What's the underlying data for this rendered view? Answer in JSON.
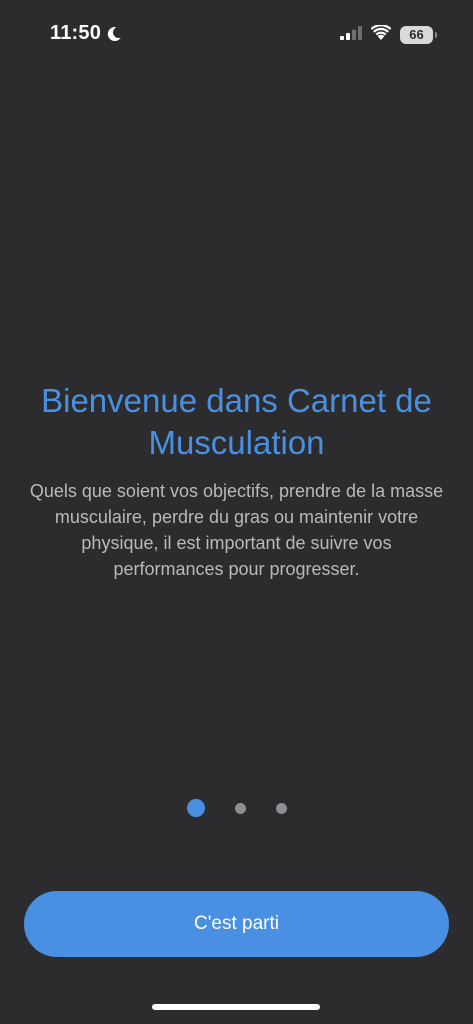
{
  "status_bar": {
    "time": "11:50",
    "battery": "66",
    "icons": [
      "moon-icon",
      "cellular-signal-icon",
      "wifi-icon",
      "battery-icon"
    ]
  },
  "onboarding": {
    "title": "Bienvenue dans Carnet de Musculation",
    "description": "Quels que soient vos objectifs, prendre de la masse musculaire, perdre du gras ou maintenir votre physique, il est important de suivre vos performances pour progresser.",
    "page_count": 3,
    "current_page": 1,
    "cta_label": "C'est parti"
  },
  "colors": {
    "background": "#2c2c2e",
    "accent": "#4a90e2",
    "text_secondary": "#b9b9bb",
    "dot_inactive": "#8e8e93"
  }
}
